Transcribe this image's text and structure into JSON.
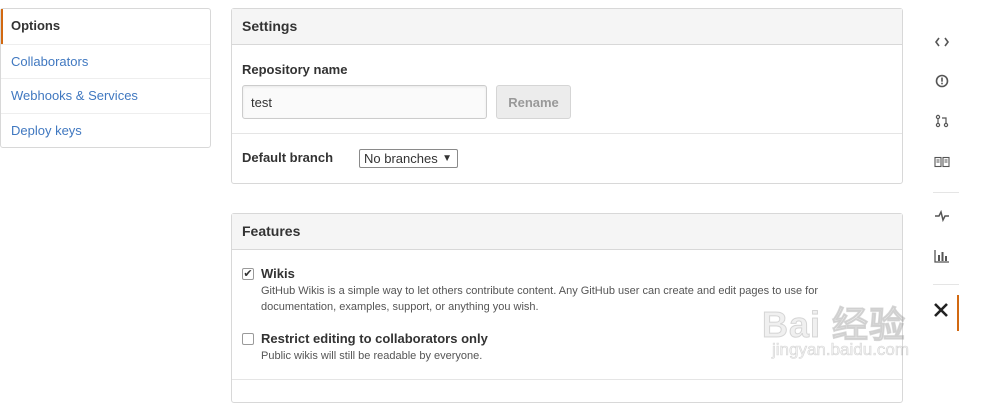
{
  "sidebar": {
    "items": [
      {
        "label": "Options",
        "selected": true
      },
      {
        "label": "Collaborators",
        "selected": false
      },
      {
        "label": "Webhooks & Services",
        "selected": false
      },
      {
        "label": "Deploy keys",
        "selected": false
      }
    ]
  },
  "settings": {
    "title": "Settings",
    "repo_name_label": "Repository name",
    "repo_name_value": "test",
    "rename_button": "Rename",
    "default_branch_label": "Default branch",
    "default_branch_value": "No branches"
  },
  "features": {
    "title": "Features",
    "items": [
      {
        "title": "Wikis",
        "checked": true,
        "description": "GitHub Wikis is a simple way to let others contribute content. Any GitHub user can create and edit pages to use for documentation, examples, support, or anything you wish."
      },
      {
        "title": "Restrict editing to collaborators only",
        "checked": false,
        "description": "Public wikis will still be readable by everyone."
      }
    ]
  },
  "right_nav": {
    "icons": [
      "code-icon",
      "issues-icon",
      "pull-request-icon",
      "wiki-icon",
      "pulse-icon",
      "graphs-icon",
      "settings-icon"
    ],
    "active": "settings-icon",
    "accent_color": "#d26911"
  },
  "watermark": {
    "main": "Bai 经验",
    "sub": "jingyan.baidu.com"
  },
  "colors": {
    "link": "#4078c0",
    "accent": "#d26911"
  }
}
